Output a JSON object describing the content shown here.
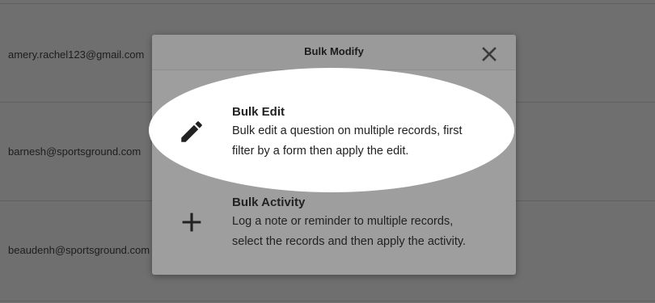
{
  "background": {
    "rows": [
      {
        "email": "amery.rachel123@gmail.com"
      },
      {
        "email": "barnesh@sportsground.com"
      },
      {
        "email": "beaudenh@sportsground.com"
      }
    ]
  },
  "modal": {
    "title": "Bulk Modify",
    "close_icon": "close-icon",
    "options": [
      {
        "icon": "pencil-icon",
        "title": "Bulk Edit",
        "desc_line1": "Bulk edit a question on multiple records, first",
        "desc_line2": "filter by a form then apply the edit."
      },
      {
        "icon": "plus-icon",
        "title": "Bulk Activity",
        "desc_line1": "Log a note or reminder to multiple records,",
        "desc_line2": "select the records and then apply the activity."
      }
    ]
  },
  "colors": {
    "overlay": "#6f6f6f",
    "modal_bg": "#9e9e9e",
    "spotlight": "#ffffff"
  }
}
